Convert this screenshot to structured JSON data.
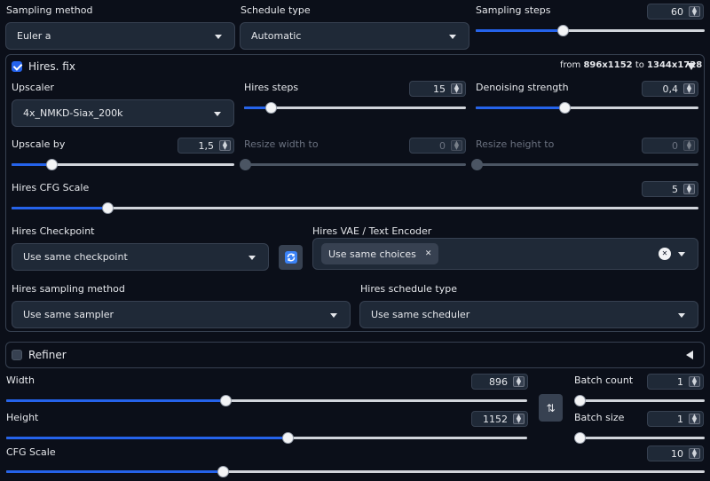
{
  "top": {
    "sampling_method_label": "Sampling method",
    "sampling_method_value": "Euler a",
    "schedule_type_label": "Schedule type",
    "schedule_type_value": "Automatic",
    "sampling_steps_label": "Sampling steps",
    "sampling_steps_value": "60",
    "sampling_steps_fraction": 0.38
  },
  "hires": {
    "title": "Hires. fix",
    "enabled": true,
    "from_label": "from",
    "from_size": "896x1152",
    "to_label": "to",
    "to_size": "1344x1728",
    "upscaler_label": "Upscaler",
    "upscaler_value": "4x_NMKD-Siax_200k",
    "hires_steps_label": "Hires steps",
    "hires_steps_value": "15",
    "hires_steps_fraction": 0.12,
    "denoising_label": "Denoising strength",
    "denoising_value": "0,4",
    "denoising_fraction": 0.4,
    "upscale_by_label": "Upscale by",
    "upscale_by_value": "1,5",
    "upscale_by_fraction": 0.18,
    "resize_width_label": "Resize width to",
    "resize_width_value": "0",
    "resize_height_label": "Resize height to",
    "resize_height_value": "0",
    "cfg_label": "Hires CFG Scale",
    "cfg_value": "5",
    "cfg_fraction": 0.14,
    "checkpoint_label": "Hires Checkpoint",
    "checkpoint_value": "Use same checkpoint",
    "vae_label": "Hires VAE / Text Encoder",
    "vae_chip": "Use same choices",
    "sampling_label": "Hires sampling method",
    "sampling_value": "Use same sampler",
    "schedule_label": "Hires schedule type",
    "schedule_value": "Use same scheduler"
  },
  "refiner": {
    "title": "Refiner",
    "enabled": false
  },
  "size": {
    "width_label": "Width",
    "width_value": "896",
    "width_fraction": 0.42,
    "height_label": "Height",
    "height_value": "1152",
    "height_fraction": 0.54,
    "batch_count_label": "Batch count",
    "batch_count_value": "1",
    "batch_count_fraction": 0.0,
    "batch_size_label": "Batch size",
    "batch_size_value": "1",
    "batch_size_fraction": 0.0,
    "cfg_label": "CFG Scale",
    "cfg_value": "10",
    "cfg_fraction": 0.31
  },
  "colors": {
    "accent": "#2563eb",
    "background": "#0b0f19",
    "input_bg": "#1f2937",
    "border": "#374151"
  },
  "icons": {
    "refresh": "refresh-icon",
    "swap": "swap-dimensions-icon",
    "clear": "clear-icon",
    "collapse": "triangle-icon"
  }
}
